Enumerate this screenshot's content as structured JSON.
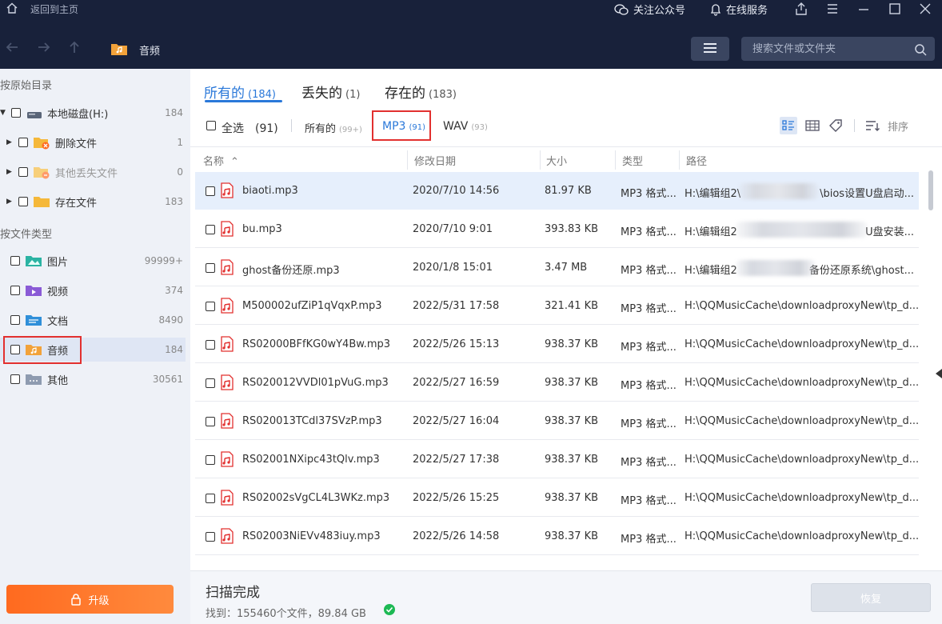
{
  "titlebar": {
    "back_home": "返回到主页",
    "follow": "关注公众号",
    "service": "在线服务"
  },
  "nav": {
    "breadcrumb": "音频",
    "search_placeholder": "搜索文件或文件夹"
  },
  "sidebar": {
    "section_dir": "按原始目录",
    "section_type": "按文件类型",
    "dir_items": [
      {
        "label": "本地磁盘(H:)",
        "count": "184"
      },
      {
        "label": "删除文件",
        "count": "1"
      },
      {
        "label": "其他丢失文件",
        "count": "0"
      },
      {
        "label": "存在文件",
        "count": "183"
      }
    ],
    "type_items": [
      {
        "label": "图片",
        "count": "99999+"
      },
      {
        "label": "视频",
        "count": "374"
      },
      {
        "label": "文档",
        "count": "8490"
      },
      {
        "label": "音频",
        "count": "184"
      },
      {
        "label": "其他",
        "count": "30561"
      }
    ],
    "upgrade": "升级"
  },
  "tabs": [
    {
      "label": "所有的",
      "count": "(184)"
    },
    {
      "label": "丢失的",
      "count": "(1)"
    },
    {
      "label": "存在的",
      "count": "(183)"
    }
  ],
  "filters": {
    "select_all": "全选",
    "select_all_count": "(91)",
    "all": "所有的",
    "all_count": "(99+)",
    "mp3": "MP3",
    "mp3_count": "(91)",
    "wav": "WAV",
    "wav_count": "(93)",
    "sort": "排序"
  },
  "columns": [
    "名称",
    "修改日期",
    "大小",
    "类型",
    "路径"
  ],
  "rows": [
    {
      "name": "biaoti.mp3",
      "date": "2020/7/10 14:56",
      "size": "81.97 KB",
      "type": "MP3 格式...",
      "path_a": "H:\\编辑组2\\",
      "path_b": "\\bios设置U盘启动..."
    },
    {
      "name": "bu.mp3",
      "date": "2020/7/10 9:01",
      "size": "393.83 KB",
      "type": "MP3 格式...",
      "path_a": "H:\\编辑组2",
      "path_b": "U盘安装..."
    },
    {
      "name": "ghost备份还原.mp3",
      "date": "2020/1/8 15:01",
      "size": "3.47 MB",
      "type": "MP3 格式...",
      "path_a": "H:\\编辑组2",
      "path_b": "备份还原系统\\ghost..."
    },
    {
      "name": "M500002ufZiP1qVqxP.mp3",
      "date": "2022/5/31 17:58",
      "size": "321.41 KB",
      "type": "MP3 格式...",
      "path_a": "H:\\QQMusicCache\\downloadproxyNew\\tp_d...",
      "path_b": ""
    },
    {
      "name": "RS02000BFfKG0wY4Bw.mp3",
      "date": "2022/5/26 15:13",
      "size": "938.37 KB",
      "type": "MP3 格式...",
      "path_a": "H:\\QQMusicCache\\downloadproxyNew\\tp_d...",
      "path_b": ""
    },
    {
      "name": "RS020012VVDl01pVuG.mp3",
      "date": "2022/5/27 16:59",
      "size": "938.37 KB",
      "type": "MP3 格式...",
      "path_a": "H:\\QQMusicCache\\downloadproxyNew\\tp_d...",
      "path_b": ""
    },
    {
      "name": "RS020013TCdl37SVzP.mp3",
      "date": "2022/5/27 16:04",
      "size": "938.37 KB",
      "type": "MP3 格式...",
      "path_a": "H:\\QQMusicCache\\downloadproxyNew\\tp_d...",
      "path_b": ""
    },
    {
      "name": "RS02001NXipc43tQlv.mp3",
      "date": "2022/5/27 17:38",
      "size": "938.37 KB",
      "type": "MP3 格式...",
      "path_a": "H:\\QQMusicCache\\downloadproxyNew\\tp_d...",
      "path_b": ""
    },
    {
      "name": "RS02002sVgCL4L3WKz.mp3",
      "date": "2022/5/26 15:25",
      "size": "938.37 KB",
      "type": "MP3 格式...",
      "path_a": "H:\\QQMusicCache\\downloadproxyNew\\tp_d...",
      "path_b": ""
    },
    {
      "name": "RS02003NiEVv483iuy.mp3",
      "date": "2022/5/26 14:58",
      "size": "938.37 KB",
      "type": "MP3 格式...",
      "path_a": "H:\\QQMusicCache\\downloadproxyNew\\tp_d...",
      "path_b": ""
    }
  ],
  "footer": {
    "status": "扫描完成",
    "found": "找到：155460个文件，89.84 GB",
    "recover": "恢复"
  },
  "colors": {
    "accent": "#2a78d9",
    "highlight_box": "#e2302f",
    "upgrade": "#ff6a1f",
    "titlebar": "#18213a"
  }
}
